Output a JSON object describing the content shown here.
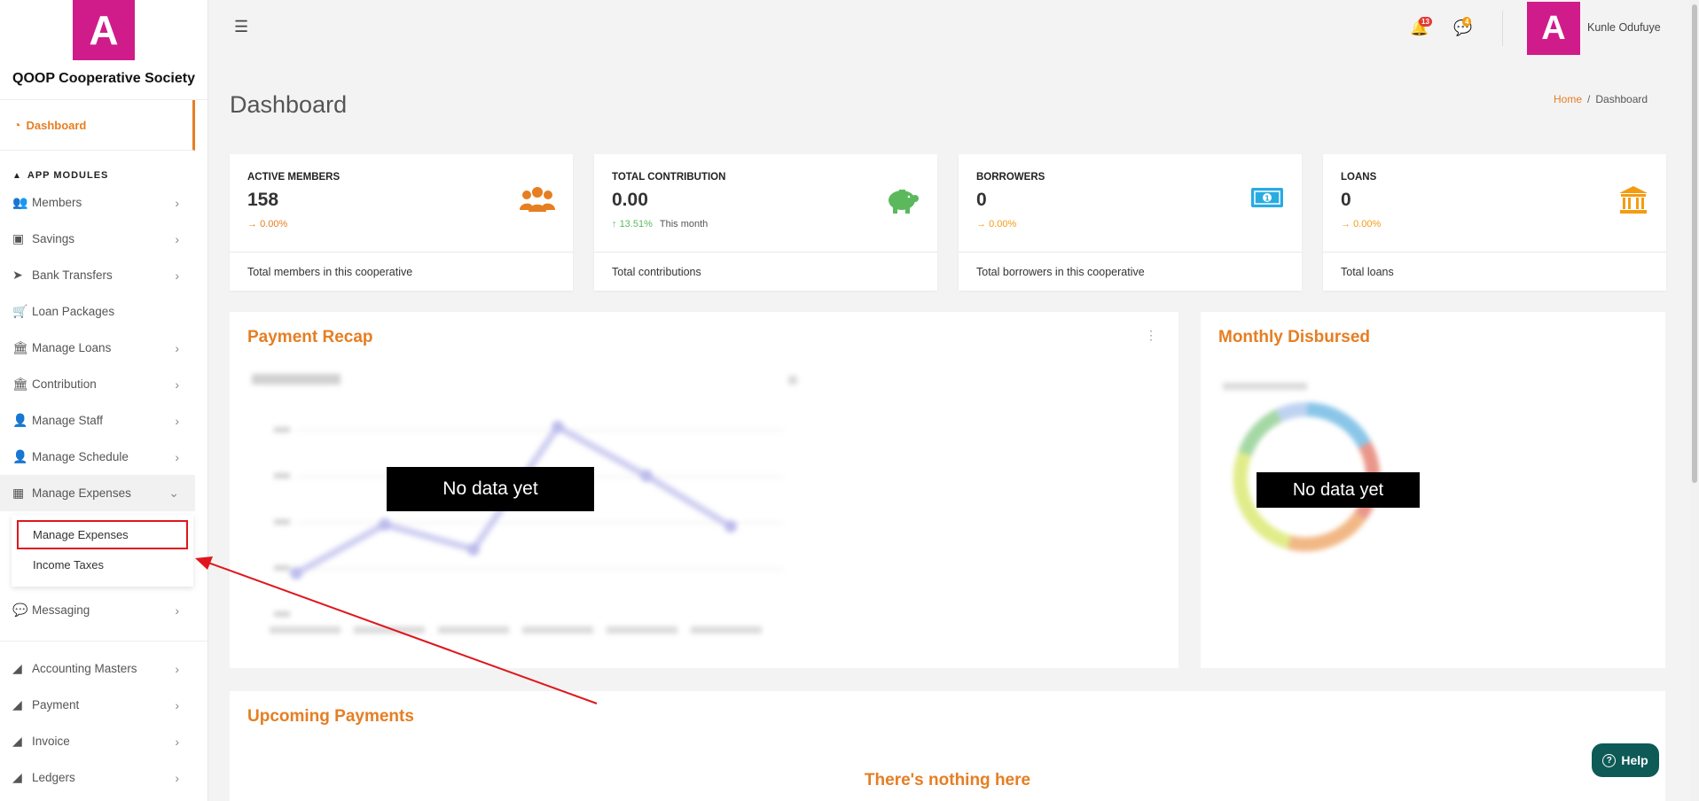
{
  "brand": {
    "logo_letter": "A",
    "name": "QOOP Cooperative Society"
  },
  "sidebar": {
    "dashboard_label": "Dashboard",
    "section_title": "APP MODULES",
    "items": [
      {
        "label": "Members",
        "icon": "users-icon"
      },
      {
        "label": "Savings",
        "icon": "money-icon"
      },
      {
        "label": "Bank Transfers",
        "icon": "paper-plane-icon"
      },
      {
        "label": "Loan Packages",
        "icon": "cart-icon"
      },
      {
        "label": "Manage Loans",
        "icon": "bank-icon"
      },
      {
        "label": "Contribution",
        "icon": "bank-icon"
      },
      {
        "label": "Manage Staff",
        "icon": "user-icon"
      },
      {
        "label": "Manage Schedule",
        "icon": "user-icon"
      },
      {
        "label": "Manage Expenses",
        "icon": "calculator-icon"
      }
    ],
    "submenu": [
      "Manage Expenses",
      "Income Taxes"
    ],
    "messaging_label": "Messaging",
    "bottom_items": [
      {
        "label": "Accounting Masters"
      },
      {
        "label": "Payment"
      },
      {
        "label": "Invoice"
      },
      {
        "label": "Ledgers"
      }
    ]
  },
  "topbar": {
    "notifications_count": "13",
    "messages_count": "4",
    "user_initial": "A",
    "user_name": "Kunle Odufuye"
  },
  "page": {
    "title": "Dashboard",
    "breadcrumb_home": "Home",
    "breadcrumb_sep": "/",
    "breadcrumb_current": "Dashboard"
  },
  "stats": [
    {
      "label": "ACTIVE MEMBERS",
      "value": "158",
      "change": "0.00%",
      "change_arrow": "→",
      "note": "",
      "footer": "Total members in this cooperative",
      "color": "#e67e22",
      "icon": "users-icon"
    },
    {
      "label": "TOTAL CONTRIBUTION",
      "value": "0.00",
      "change": "13.51%",
      "change_arrow": "↑",
      "note": "This month",
      "footer": "Total contributions",
      "color": "#5cb85c",
      "icon": "piggy-bank-icon"
    },
    {
      "label": "BORROWERS",
      "value": "0",
      "change": "0.00%",
      "change_arrow": "→",
      "note": "",
      "footer": "Total borrowers in this cooperative",
      "color": "#29abe2",
      "icon": "money-bill-icon"
    },
    {
      "label": "LOANS",
      "value": "0",
      "change": "0.00%",
      "change_arrow": "→",
      "note": "",
      "footer": "Total loans",
      "color": "#f39c12",
      "icon": "bank-icon"
    }
  ],
  "panels": {
    "payment_recap_title": "Payment Recap",
    "monthly_disbursed_title": "Monthly Disbursed",
    "upcoming_payments_title": "Upcoming Payments",
    "no_data": "No data yet",
    "nothing_here": "There's nothing here"
  },
  "help_label": "Help",
  "colors": {
    "accent": "#e67e22",
    "brand": "#d01c8b",
    "help": "#0d5a57",
    "annotation": "#e0161e"
  }
}
